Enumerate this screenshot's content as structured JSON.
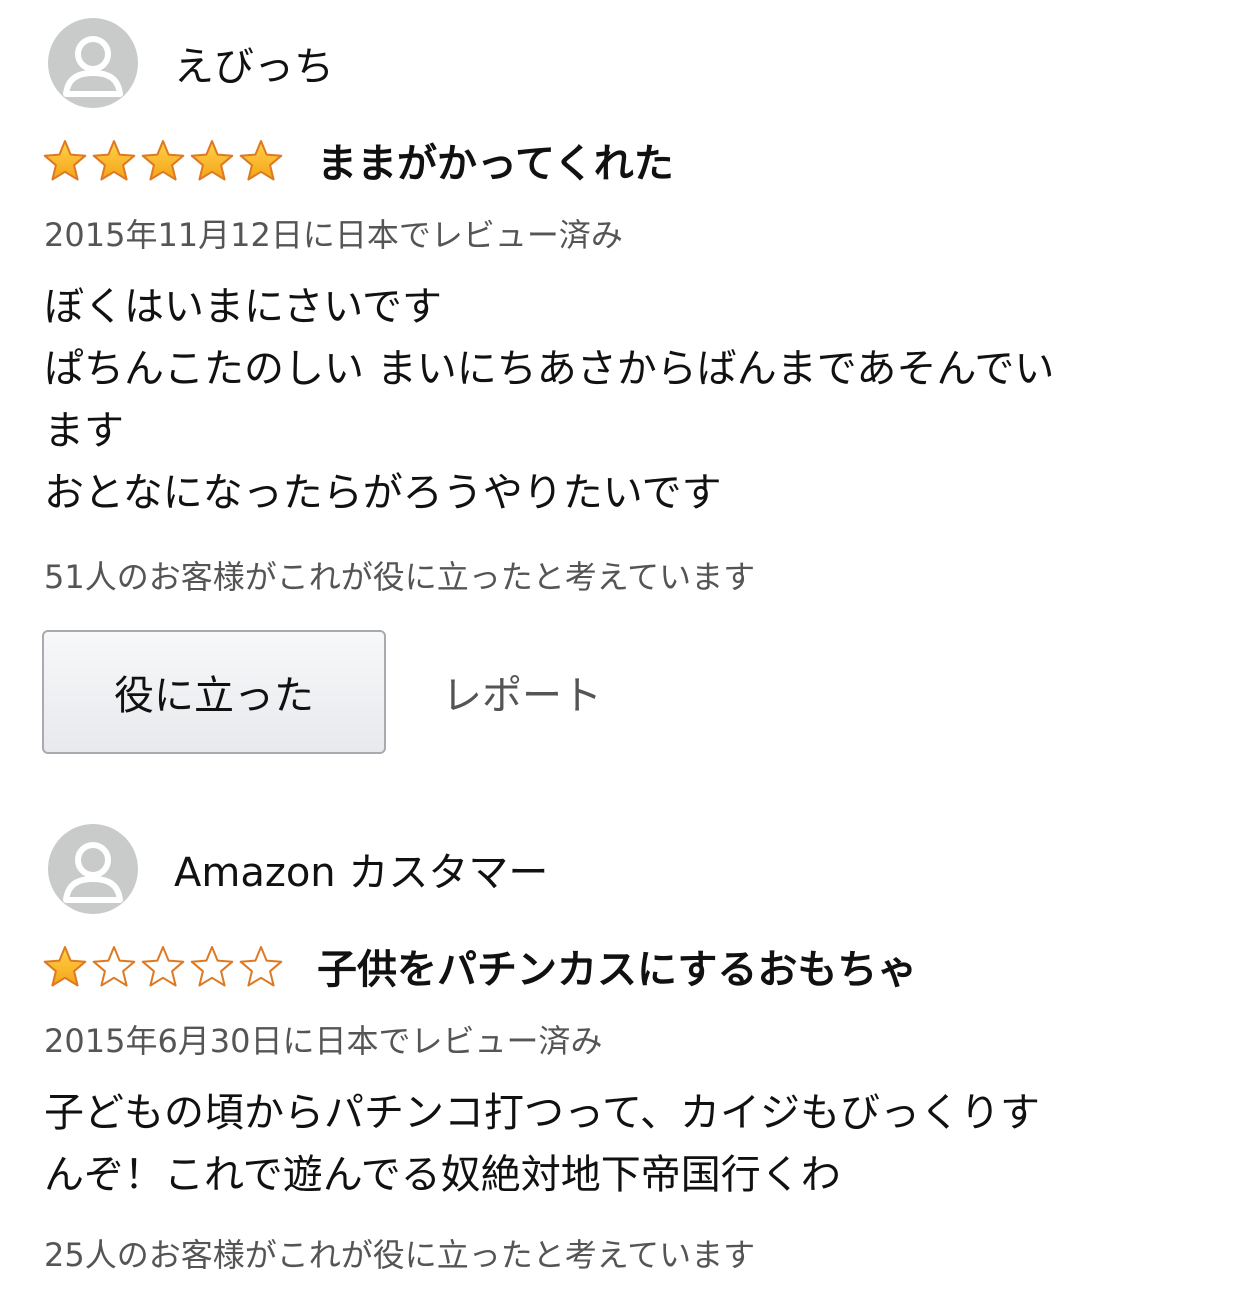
{
  "reviews": [
    {
      "reviewer_name": "えびっち",
      "rating": 5,
      "max_rating": 5,
      "title": "ままがかってくれた",
      "date": "2015年11月12日に日本でレビュー済み",
      "body_lines": [
        "ぼくはいまにさいです",
        "ぱちんこたのしい まいにちあさからばんまであそんでい",
        "ます",
        "おとなになったらがろうやりたいです"
      ],
      "helpful_count": "51人のお客様がこれが役に立ったと考えています",
      "helpful_button": "役に立った",
      "report_link": "レポート"
    },
    {
      "reviewer_name": "Amazon カスタマー",
      "rating": 1,
      "max_rating": 5,
      "title": "子供をパチンカスにするおもちゃ",
      "date": "2015年6月30日に日本でレビュー済み",
      "body_lines": [
        "子どもの頃からパチンコ打つって、カイジもびっくりす",
        "んぞ！これで遊んでる奴絶対地下帝国行くわ"
      ],
      "helpful_count": "25人のお客様がこれが役に立ったと考えています"
    }
  ],
  "colors": {
    "star_filled": "#f4a418",
    "star_outline": "#de7921",
    "avatar_bg": "#c9cbcb",
    "muted_text": "#555555"
  },
  "icons": {
    "avatar": "person-silhouette-icon",
    "star_filled": "star-filled-icon",
    "star_empty": "star-empty-icon"
  }
}
